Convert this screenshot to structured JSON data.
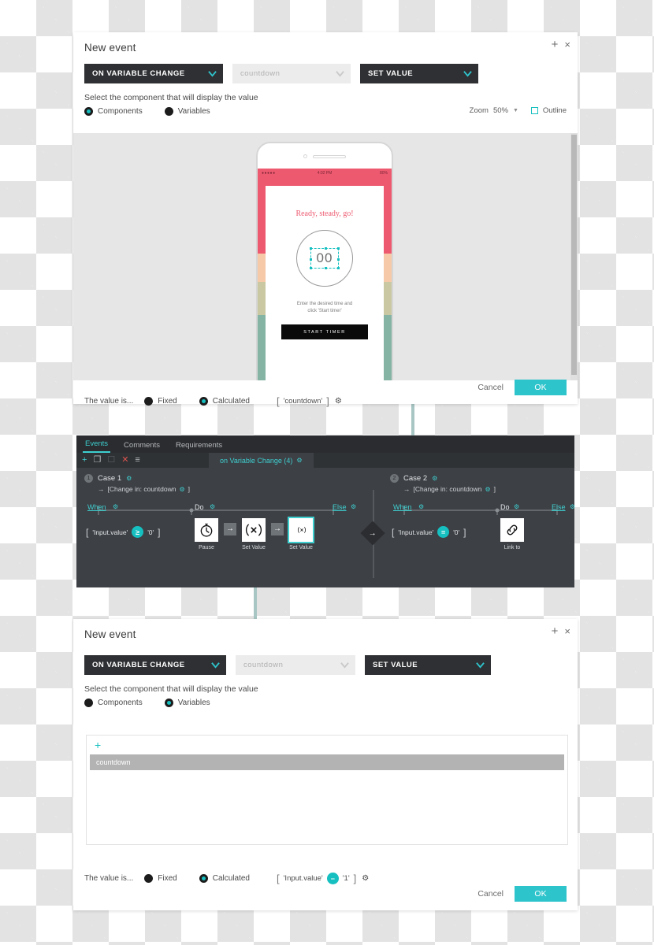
{
  "panel_top": {
    "title": "New event",
    "icons": {
      "add": "+",
      "close": "×"
    },
    "selects": {
      "trigger": "ON VARIABLE CHANGE",
      "target": "countdown",
      "action": "SET VALUE"
    },
    "instruction": "Select the component that will display the value",
    "radios": [
      {
        "label": "Components",
        "selected": true
      },
      {
        "label": "Variables",
        "selected": false
      }
    ],
    "zoom": {
      "label": "Zoom",
      "value": "50%",
      "outline_label": "Outline",
      "outline_checked": false
    },
    "value_row": {
      "label": "The value is...",
      "fixed": "Fixed",
      "calculated": "Calculated",
      "formula": {
        "open": "[",
        "left": "'countdown'",
        "close": "]"
      }
    },
    "buttons": {
      "cancel": "Cancel",
      "ok": "OK"
    }
  },
  "phone": {
    "status": {
      "left": "●●●●●",
      "time": "4:02 PM",
      "battery": "80%"
    },
    "headline": "Ready, steady, go!",
    "timer_value": "00",
    "hint_line1": "Enter the desired time and",
    "hint_line2": "click 'Start timer'",
    "start_button": "START TIMER",
    "colors": {
      "accent_pink": "#ed5a70",
      "strip_peach": "#f6c9a8",
      "strip_khaki": "#c9c8a2",
      "strip_green": "#85b3a4"
    }
  },
  "events_panel": {
    "tabs": [
      {
        "label": "Events",
        "active": true
      },
      {
        "label": "Comments",
        "active": false
      },
      {
        "label": "Requirements",
        "active": false
      }
    ],
    "toolbar_icons": [
      "add-icon",
      "duplicate-icon",
      "paste-icon",
      "delete-icon",
      "list-icon"
    ],
    "subtab": "on Variable Change (4)",
    "case1": {
      "number": "1",
      "name": "Case 1",
      "change": "[Change in:  countdown",
      "change_close": "]",
      "when": "When",
      "do": "Do",
      "else": "Else",
      "condition": {
        "open": "[",
        "left": "'Input.value'",
        "op": "≥",
        "right": "'0'",
        "close": "]"
      },
      "actions": [
        {
          "label": "Pause",
          "icon": "stopwatch-icon",
          "selected": false
        },
        {
          "label": "Set Value",
          "icon": "set-value-icon",
          "selected": false
        },
        {
          "label": "Set Value",
          "icon": "set-value-icon",
          "selected": true
        }
      ]
    },
    "case2": {
      "number": "2",
      "name": "Case 2",
      "change": "[Change in:  countdown",
      "change_close": "]",
      "when": "When",
      "do": "Do",
      "else": "Else",
      "condition": {
        "open": "[",
        "left": "'Input.value'",
        "op": "=",
        "right": "'0'",
        "close": "]"
      },
      "actions": [
        {
          "label": "Link to",
          "icon": "link-icon",
          "selected": false
        }
      ]
    }
  },
  "panel_bottom": {
    "title": "New event",
    "icons": {
      "add": "+",
      "close": "×"
    },
    "selects": {
      "trigger": "ON VARIABLE CHANGE",
      "target": "countdown",
      "action": "SET VALUE"
    },
    "instruction": "Select the component that will display the value",
    "radios": [
      {
        "label": "Components",
        "selected": false
      },
      {
        "label": "Variables",
        "selected": true
      }
    ],
    "variable_list": {
      "add": "+",
      "items": [
        "countdown"
      ]
    },
    "value_row": {
      "label": "The value is...",
      "fixed": "Fixed",
      "calculated": "Calculated",
      "formula": {
        "open": "[",
        "left": "'Input.value'",
        "op": "−",
        "right": "'1'",
        "close": "]"
      }
    },
    "buttons": {
      "cancel": "Cancel",
      "ok": "OK"
    }
  }
}
